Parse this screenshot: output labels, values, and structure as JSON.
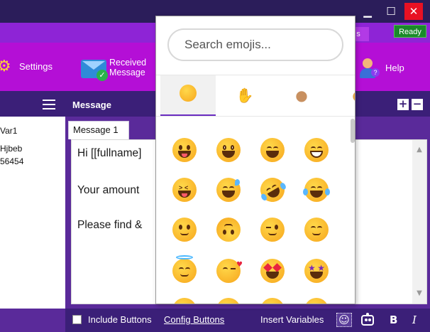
{
  "window": {
    "minimize_glyph": "▁",
    "maximize_glyph": "☐",
    "close_glyph": "✕"
  },
  "status": {
    "tab_label": "s",
    "ready": "Ready"
  },
  "ribbon": {
    "settings_label": "Settings",
    "received_line1": "Received",
    "received_line2": "Message",
    "help_label": "Help"
  },
  "variables": {
    "items": [
      "Var1",
      "Hjbeb",
      "56454"
    ]
  },
  "message": {
    "title": "Message",
    "plus": "+",
    "minus": "−",
    "tab": "Message 1",
    "lines": [
      "Hi [[fullname]",
      "Your amount",
      "Please find &"
    ]
  },
  "bottom_bar": {
    "include_buttons": "Include Buttons",
    "config_buttons": "Config Buttons",
    "insert_variables": "Insert Variables",
    "emoji_glyph": "☺",
    "bold": "B",
    "italic": "I"
  },
  "emoji_picker": {
    "search_placeholder": "Search emojis...",
    "categories": [
      "smileys",
      "people",
      "animals",
      "food"
    ],
    "active_category": "smileys",
    "emojis": [
      "grinning-face-big-eyes",
      "grinning-face-open",
      "beaming-face",
      "grinning-teeth",
      "squinting-laugh",
      "grinning-sweat",
      "rolling-on-floor-laughing",
      "tears-of-joy",
      "slightly-smiling",
      "upside-down-face",
      "winking-face",
      "smiling-eyes",
      "smiling-halo",
      "blowing-kiss",
      "heart-eyes",
      "star-struck"
    ]
  },
  "colors": {
    "titlebar": "#2b1d5a",
    "ribbon": "#b40fd6",
    "panel_header": "#3b1f78",
    "accent": "#6a2cc0",
    "ready": "#1a8a2a"
  }
}
